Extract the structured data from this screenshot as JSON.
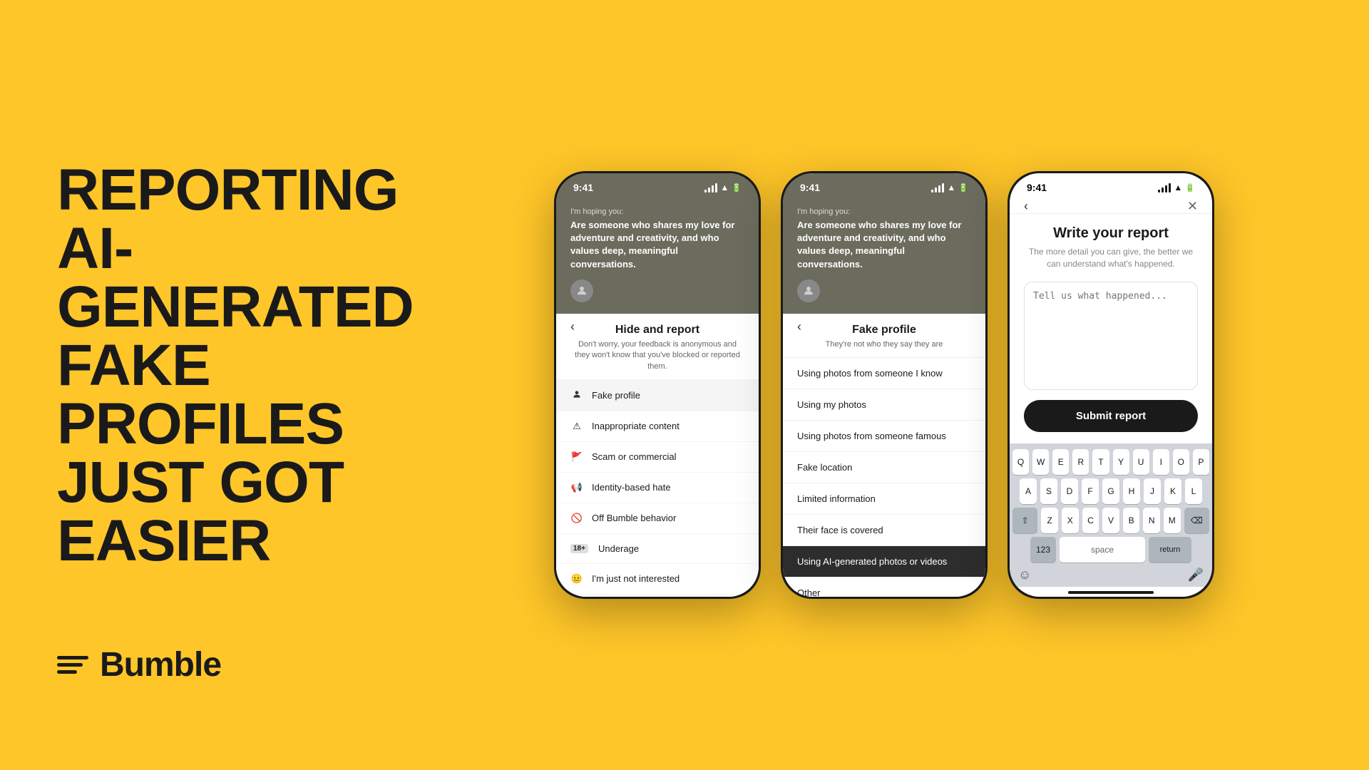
{
  "background_color": "#FFC629",
  "headline": {
    "line1": "REPORTING",
    "line2": "AI-GENERATED",
    "line3": "FAKE PROFILES",
    "line4": "JUST GOT",
    "line5": "EASIER"
  },
  "brand": {
    "name": "Bumble"
  },
  "phone1": {
    "status_time": "9:41",
    "bg_label": "I'm hoping you:",
    "bg_text": "Are someone who shares my love for adventure and creativity, and who values deep, meaningful conversations.",
    "sheet_title": "Hide and report",
    "sheet_subtitle": "Don't worry, your feedback is anonymous and they won't know that you've blocked or reported them.",
    "menu_items": [
      {
        "icon": "👤",
        "label": "Fake profile",
        "highlighted": true
      },
      {
        "icon": "⚠",
        "label": "Inappropriate content"
      },
      {
        "icon": "🚩",
        "label": "Scam or commercial"
      },
      {
        "icon": "📢",
        "label": "Identity-based hate"
      },
      {
        "icon": "🚫",
        "label": "Off Bumble behavior"
      },
      {
        "icon": "18+",
        "label": "Underage",
        "badge": true
      },
      {
        "icon": "😐",
        "label": "I'm just not interested"
      }
    ]
  },
  "phone2": {
    "status_time": "9:41",
    "bg_label": "I'm hoping you:",
    "bg_text": "Are someone who shares my love for adventure and creativity, and who values deep, meaningful conversations.",
    "sheet_title": "Fake profile",
    "sheet_subtitle": "They're not who they say they are",
    "sub_items": [
      {
        "label": "Using photos from someone I know"
      },
      {
        "label": "Using my photos"
      },
      {
        "label": "Using photos from someone famous"
      },
      {
        "label": "Fake location"
      },
      {
        "label": "Limited information"
      },
      {
        "label": "Their face is covered"
      },
      {
        "label": "Using AI-generated photos or videos",
        "highlighted": true
      },
      {
        "label": "Other"
      }
    ]
  },
  "phone3": {
    "status_time": "9:41",
    "report_title": "Write your report",
    "report_desc": "The more detail you can give, the better we can understand what's happened.",
    "textarea_placeholder": "Tell us what happened...",
    "submit_label": "Submit report",
    "keyboard_rows": [
      [
        "Q",
        "W",
        "E",
        "R",
        "T",
        "Y",
        "U",
        "I",
        "O",
        "P"
      ],
      [
        "A",
        "S",
        "D",
        "F",
        "G",
        "H",
        "J",
        "K",
        "L"
      ],
      [
        "⇧",
        "Z",
        "X",
        "C",
        "V",
        "B",
        "N",
        "M",
        "⌫"
      ],
      [
        "123",
        "space",
        "return"
      ]
    ]
  }
}
